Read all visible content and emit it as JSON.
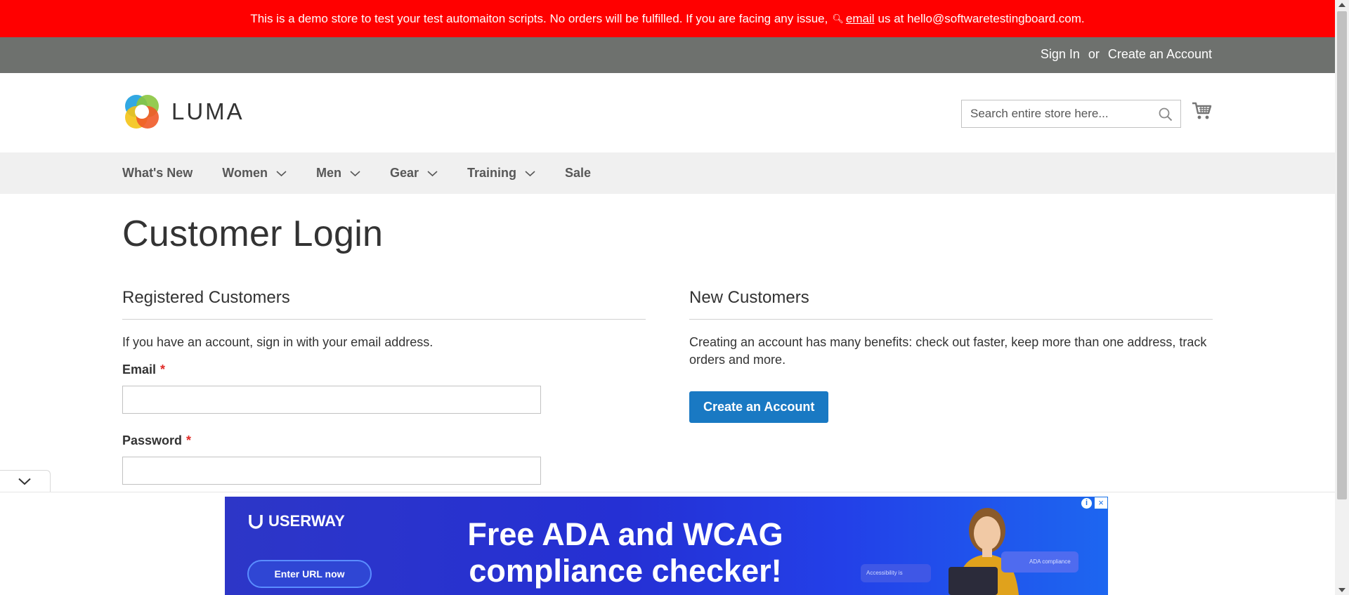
{
  "demo_banner": {
    "text_before": "This is a demo store to test your test automaiton scripts. No orders will be fulfilled. If you are facing any issue,",
    "link_icon": "magnifier-icon",
    "link_text": "email",
    "text_after": "us at hello@softwaretestingboard.com."
  },
  "topbar": {
    "sign_in": "Sign In",
    "separator": "or",
    "create_account": "Create an Account"
  },
  "header": {
    "logo_text": "LUMA",
    "search_placeholder": "Search entire store here...",
    "search_icon": "search-icon",
    "cart_icon": "cart-icon"
  },
  "nav": {
    "items": [
      {
        "label": "What's New",
        "has_dropdown": false
      },
      {
        "label": "Women",
        "has_dropdown": true
      },
      {
        "label": "Men",
        "has_dropdown": true
      },
      {
        "label": "Gear",
        "has_dropdown": true
      },
      {
        "label": "Training",
        "has_dropdown": true
      },
      {
        "label": "Sale",
        "has_dropdown": false
      }
    ]
  },
  "main": {
    "page_title": "Customer Login",
    "registered": {
      "title": "Registered Customers",
      "intro": "If you have an account, sign in with your email address.",
      "email_label": "Email",
      "password_label": "Password",
      "required_mark": "*",
      "email_value": "",
      "password_value": ""
    },
    "new_customers": {
      "title": "New Customers",
      "intro": "Creating an account has many benefits: check out faster, keep more than one address, track orders and more.",
      "button": "Create an Account"
    }
  },
  "ad": {
    "brand": "USERWAY",
    "cta": "Enter URL now",
    "headline": "Free ADA and WCAG compliance checker!",
    "info_icon": "i",
    "close_icon": "×",
    "pill_left": "Accessibility is",
    "pill_right": "ADA compliance"
  },
  "colors": {
    "banner": "#ff0000",
    "topbar": "#6e716e",
    "nav_bg": "#f0f0f0",
    "primary_button": "#1979c3",
    "required": "#e02b27"
  }
}
